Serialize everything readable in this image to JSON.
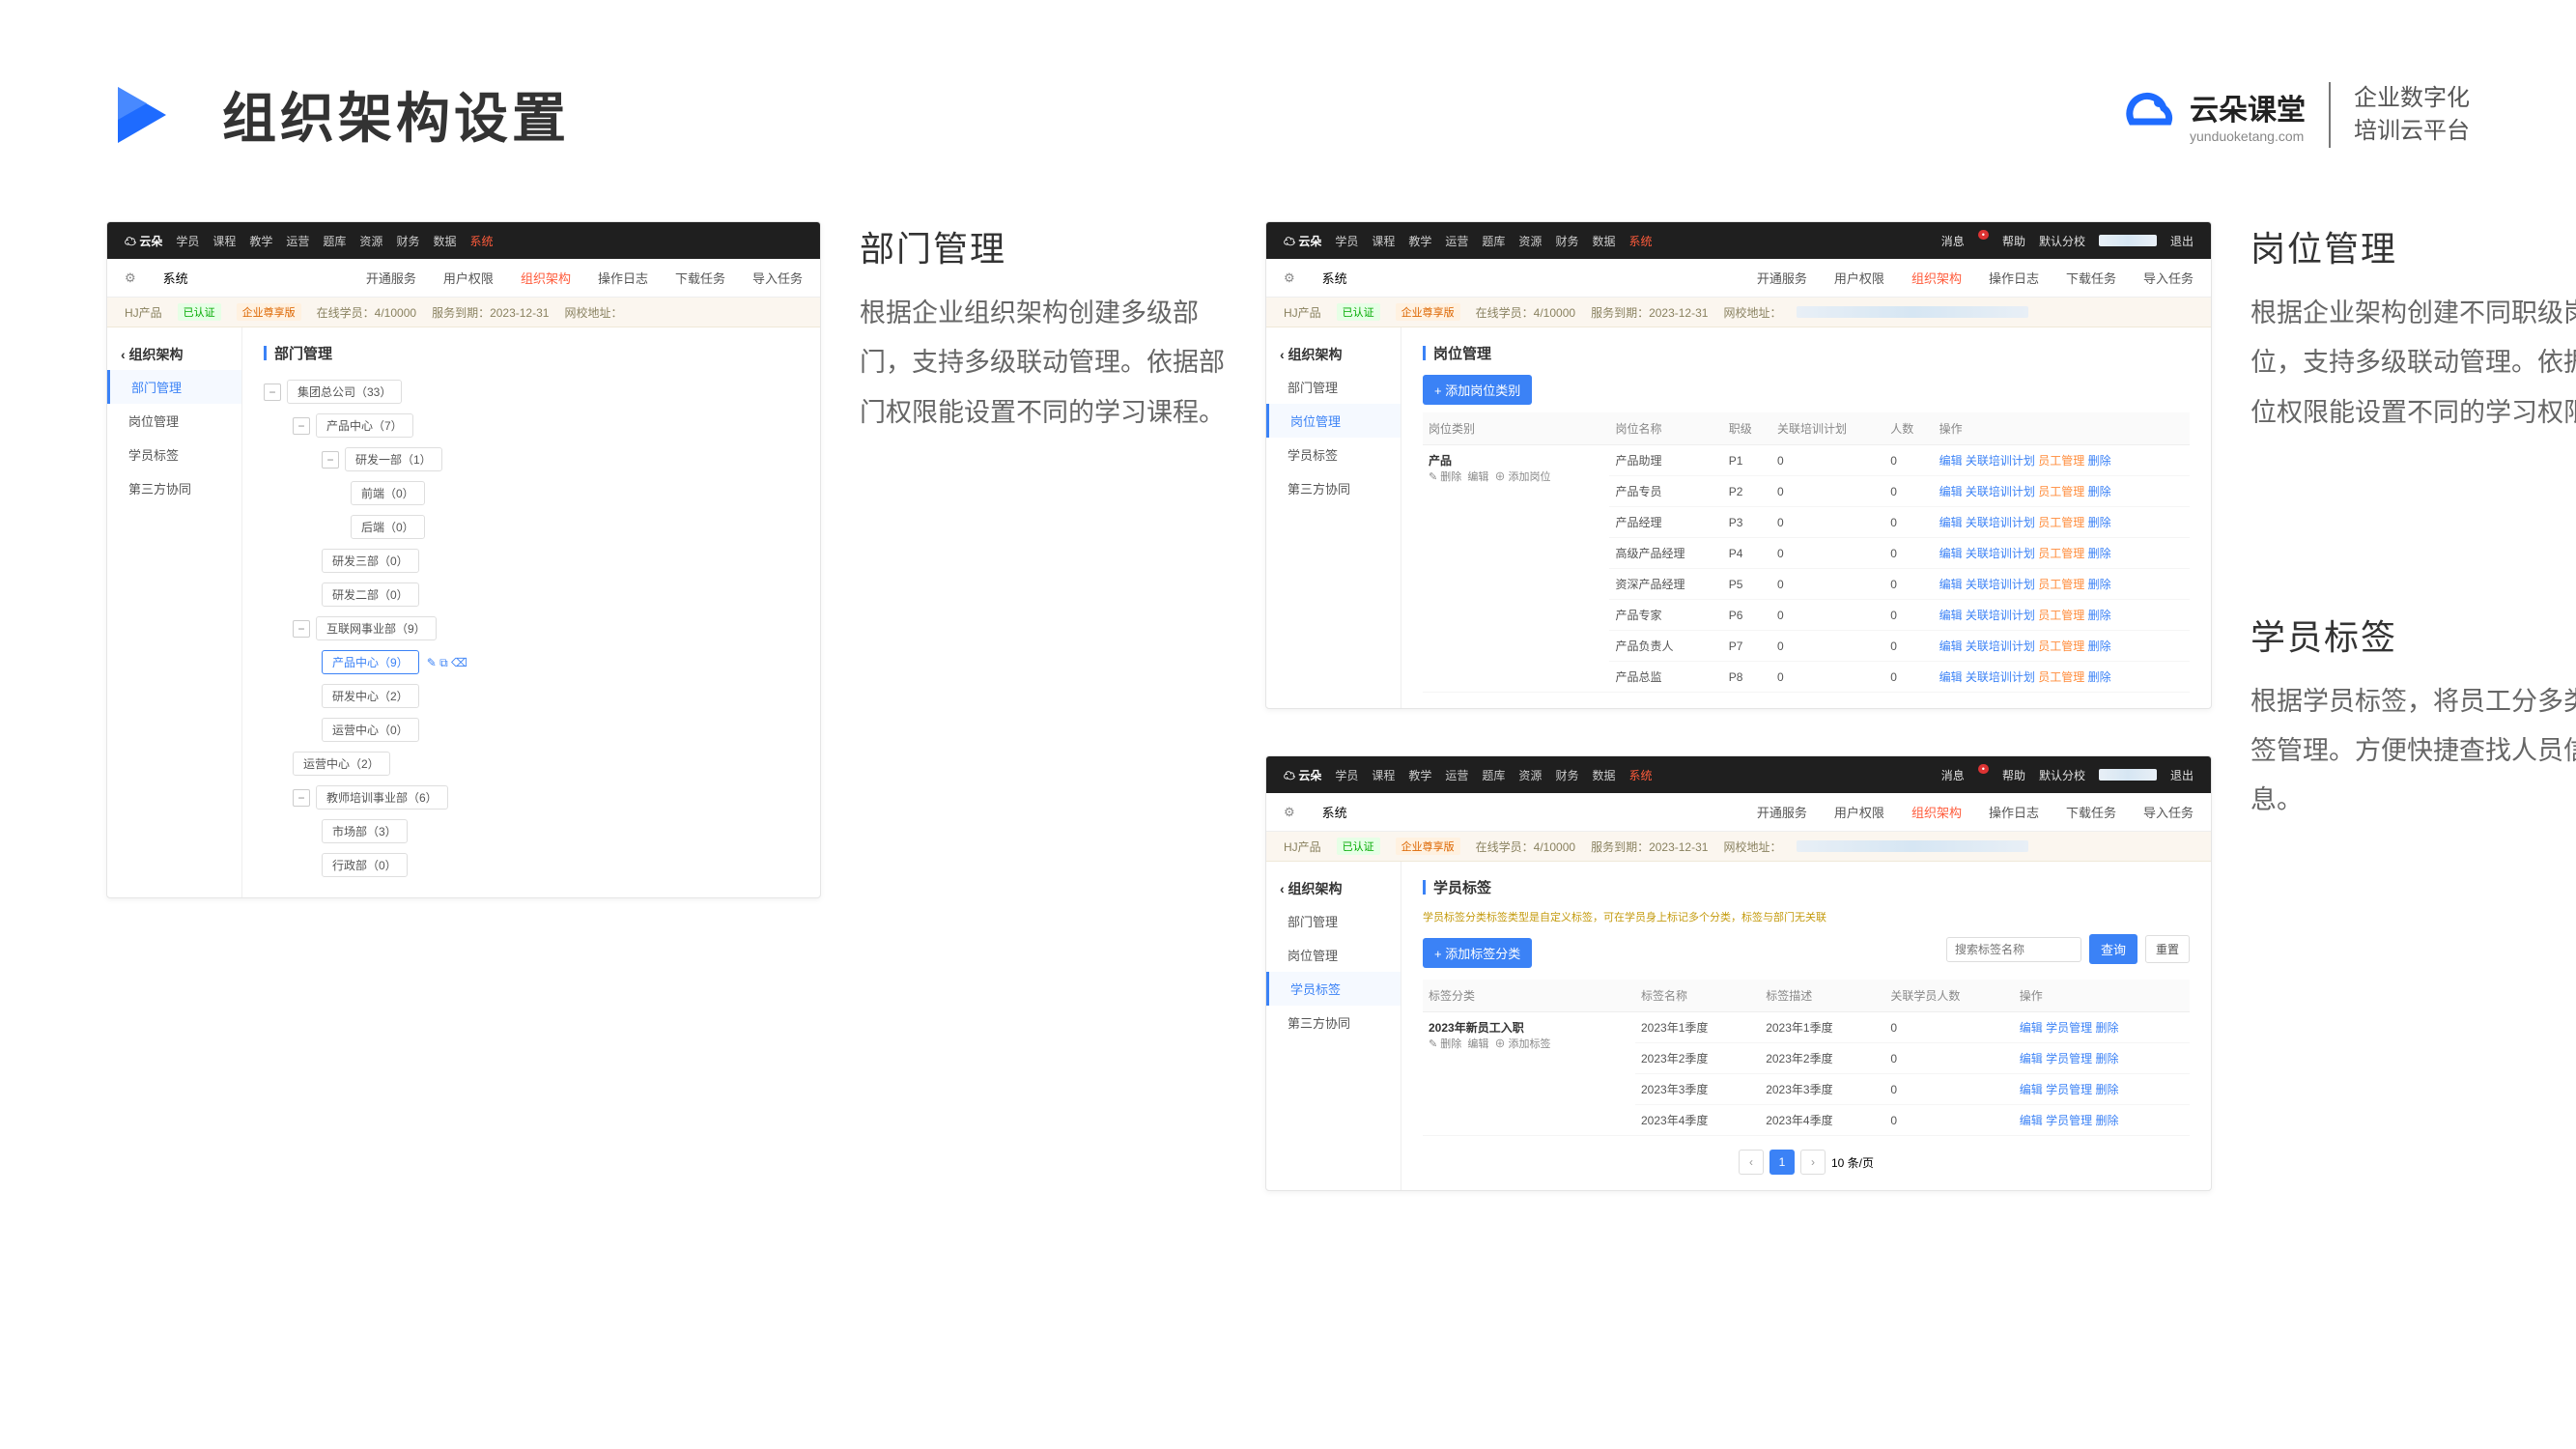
{
  "page_title": "组织架构设置",
  "brand": {
    "name": "云朵课堂",
    "domain": "yunduoketang.com",
    "tagline1": "企业数字化",
    "tagline2": "培训云平台"
  },
  "sections": {
    "dept": {
      "title": "部门管理",
      "desc": "根据企业组织架构创建多级部门，支持多级联动管理。依据部门权限能设置不同的学习课程。"
    },
    "post": {
      "title": "岗位管理",
      "desc": "根据企业架构创建不同职级岗位，支持多级联动管理。依据岗位权限能设置不同的学习权限。"
    },
    "tag": {
      "title": "学员标签",
      "desc": "根据学员标签，将员工分多类标签管理。方便快捷查找人员信息。"
    }
  },
  "topnav": {
    "items": [
      "学员",
      "课程",
      "教学",
      "运营",
      "题库",
      "资源",
      "财务",
      "数据"
    ],
    "active_highlight": "系统",
    "right": [
      "消息",
      "帮助",
      "默认分校",
      "退出"
    ]
  },
  "subnav": {
    "gear": "系统",
    "items": [
      "开通服务",
      "用户权限",
      "组织架构",
      "操作日志",
      "下载任务",
      "导入任务"
    ],
    "active_index": 2
  },
  "status": {
    "prefix": "HJ产品",
    "badge1": "已认证",
    "badge2": "企业尊享版",
    "online": "在线学员：4/10000",
    "expire": "服务到期：2023-12-31",
    "site": "网校地址："
  },
  "sidenav": {
    "back": "‹ 组织架构",
    "items": [
      "部门管理",
      "岗位管理",
      "学员标签",
      "第三方协同"
    ]
  },
  "dept_tree": {
    "panel_title": "部门管理",
    "root": "集团总公司（33）",
    "l1": [
      {
        "name": "产品中心（7）",
        "children": [
          {
            "name": "研发一部（1）",
            "children": [
              {
                "name": "前端（0）"
              },
              {
                "name": "后端（0）"
              }
            ]
          },
          {
            "name": "研发三部（0）"
          },
          {
            "name": "研发二部（0）"
          }
        ]
      },
      {
        "name": "互联网事业部（9）",
        "children": [
          {
            "name": "产品中心（9）",
            "active": true,
            "icons": true
          },
          {
            "name": "研发中心（2）"
          },
          {
            "name": "运营中心（0）"
          }
        ]
      },
      {
        "name": "运营中心（2）"
      },
      {
        "name": "教师培训事业部（6）",
        "children": [
          {
            "name": "市场部（3）"
          },
          {
            "name": "行政部（0）"
          }
        ]
      }
    ]
  },
  "post_panel": {
    "panel_title": "岗位管理",
    "add_btn": "+ 添加岗位类别",
    "columns": [
      "岗位类别",
      "岗位名称",
      "职级",
      "关联培训计划",
      "人数",
      "操作"
    ],
    "category": {
      "name": "产品",
      "ops": [
        "删除",
        "编辑",
        "添加岗位"
      ]
    },
    "rows": [
      {
        "name": "产品助理",
        "level": "P1",
        "plan": "0",
        "count": "0"
      },
      {
        "name": "产品专员",
        "level": "P2",
        "plan": "0",
        "count": "0"
      },
      {
        "name": "产品经理",
        "level": "P3",
        "plan": "0",
        "count": "0"
      },
      {
        "name": "高级产品经理",
        "level": "P4",
        "plan": "0",
        "count": "0"
      },
      {
        "name": "资深产品经理",
        "level": "P5",
        "plan": "0",
        "count": "0"
      },
      {
        "name": "产品专家",
        "level": "P6",
        "plan": "0",
        "count": "0"
      },
      {
        "name": "产品负责人",
        "level": "P7",
        "plan": "0",
        "count": "0"
      },
      {
        "name": "产品总监",
        "level": "P8",
        "plan": "0",
        "count": "0"
      }
    ],
    "op_links": [
      "编辑",
      "关联培训计划",
      "员工管理",
      "删除"
    ]
  },
  "tag_panel": {
    "panel_title": "学员标签",
    "help": "学员标签分类标签类型是自定义标签，可在学员身上标记多个分类，标签与部门无关联",
    "add_btn": "+ 添加标签分类",
    "search_placeholder": "搜索标签名称",
    "search_btn": "查询",
    "reset_btn": "重置",
    "columns": [
      "标签分类",
      "标签名称",
      "标签描述",
      "关联学员人数",
      "操作"
    ],
    "category": {
      "name": "2023年新员工入职",
      "ops": [
        "删除",
        "编辑",
        "添加标签"
      ]
    },
    "rows": [
      {
        "name": "2023年1季度",
        "desc": "2023年1季度",
        "count": "0"
      },
      {
        "name": "2023年2季度",
        "desc": "2023年2季度",
        "count": "0"
      },
      {
        "name": "2023年3季度",
        "desc": "2023年3季度",
        "count": "0"
      },
      {
        "name": "2023年4季度",
        "desc": "2023年4季度",
        "count": "0"
      }
    ],
    "op_links": [
      "编辑",
      "学员管理",
      "删除"
    ],
    "pagination": {
      "page": "1",
      "per": "10 条/页"
    }
  }
}
